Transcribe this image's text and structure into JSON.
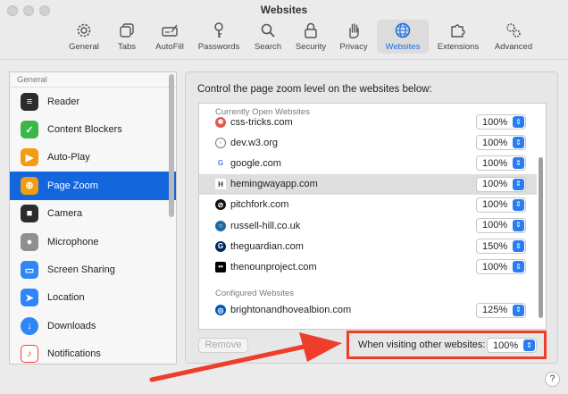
{
  "window": {
    "title": "Websites"
  },
  "toolbar": {
    "items": [
      {
        "label": "General",
        "icon": "gear-icon"
      },
      {
        "label": "Tabs",
        "icon": "tabs-icon"
      },
      {
        "label": "AutoFill",
        "icon": "autofill-icon"
      },
      {
        "label": "Passwords",
        "icon": "key-icon"
      },
      {
        "label": "Search",
        "icon": "search-icon"
      },
      {
        "label": "Security",
        "icon": "lock-icon"
      },
      {
        "label": "Privacy",
        "icon": "hand-icon"
      },
      {
        "label": "Websites",
        "icon": "globe-icon",
        "selected": true
      },
      {
        "label": "Extensions",
        "icon": "puzzle-icon"
      },
      {
        "label": "Advanced",
        "icon": "gears-icon"
      }
    ]
  },
  "sidebar": {
    "section": "General",
    "items": [
      {
        "label": "Reader",
        "icon": "reader-icon",
        "color": "#2c2c2c"
      },
      {
        "label": "Content Blockers",
        "icon": "shield-check-icon",
        "color": "#3cb54a"
      },
      {
        "label": "Auto-Play",
        "icon": "play-icon",
        "color": "#f39c12"
      },
      {
        "label": "Page Zoom",
        "icon": "zoom-icon",
        "color": "#f39c12",
        "selected": true
      },
      {
        "label": "Camera",
        "icon": "camera-icon",
        "color": "#2c2c2c"
      },
      {
        "label": "Microphone",
        "icon": "microphone-icon",
        "color": "#8e8e93"
      },
      {
        "label": "Screen Sharing",
        "icon": "screen-sharing-icon",
        "color": "#2f86f6"
      },
      {
        "label": "Location",
        "icon": "location-icon",
        "color": "#2f86f6"
      },
      {
        "label": "Downloads",
        "icon": "downloads-icon",
        "color": "#2f86f6"
      },
      {
        "label": "Notifications",
        "icon": "bell-icon",
        "color": "#ff3b30"
      }
    ]
  },
  "main": {
    "title": "Control the page zoom level on the websites below:",
    "open_section": "Currently Open Websites",
    "open_sites": [
      {
        "domain": "css-tricks.com",
        "zoom": "100%",
        "color": "#e8544a"
      },
      {
        "domain": "dev.w3.org",
        "zoom": "100%",
        "color": "#777777"
      },
      {
        "domain": "google.com",
        "zoom": "100%",
        "color": "#4285f4"
      },
      {
        "domain": "hemingwayapp.com",
        "zoom": "100%",
        "color": "#333333",
        "selected": true
      },
      {
        "domain": "pitchfork.com",
        "zoom": "100%",
        "color": "#111111"
      },
      {
        "domain": "russell-hill.co.uk",
        "zoom": "100%",
        "color": "#1a6aa5"
      },
      {
        "domain": "theguardian.com",
        "zoom": "150%",
        "color": "#052962"
      },
      {
        "domain": "thenounproject.com",
        "zoom": "100%",
        "color": "#000000"
      }
    ],
    "configured_section": "Configured Websites",
    "configured_sites": [
      {
        "domain": "brightonandhovealbion.com",
        "zoom": "125%",
        "color": "#0057b8"
      }
    ],
    "remove_label": "Remove",
    "other_label": "When visiting other websites:",
    "other_zoom": "100%",
    "help": "?"
  },
  "colors": {
    "accent": "#1466dd",
    "annotation": "#ee3d2b"
  }
}
